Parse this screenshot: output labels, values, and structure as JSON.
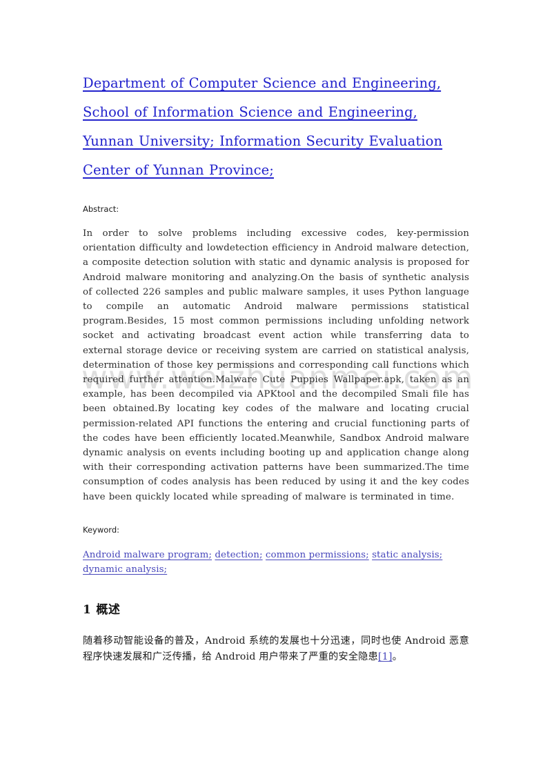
{
  "document": {
    "affiliation": {
      "lines": [
        "Department of Computer Science and Engineering,",
        "School of Information Science and Engineering,",
        "Yunnan University; Information Security ",
        "Evaluation Center of Yunnan Province;"
      ]
    },
    "abstract": {
      "label": "Abstract:",
      "text": "In order to solve problems including excessive codes, key-permission orientation difficulty and lowdetection efficiency in Android malware detection, a composite detection solution with static and dynamic analysis is proposed for Android malware monitoring and analyzing.On the basis of synthetic analysis of collected 226 samples and public malware samples, it uses Python language to compile an automatic Android malware permissions statistical program.Besides, 15 most common permissions including unfolding network socket and activating broadcast event action while transferring data to external storage device or receiving system are carried on statistical analysis, determination of those key permissions and corresponding call functions which required further attention.Malware Cute Puppies Wallpaper.apk, taken as an example, has been decompiled via APKtool and the decompiled Smali file has been obtained.By locating key codes of the malware and locating crucial permission-related API functions the entering and crucial functioning parts of the codes have been efficiently located.Meanwhile, Sandbox Android malware dynamic analysis on events including booting up and application change along with their corresponding activation patterns have been summarized.The time consumption of codes analysis has been reduced by using it and the key codes have been quickly located while spreading of malware is terminated in time."
    },
    "keywords": {
      "label": "Keyword:",
      "items": [
        "Android malware program;",
        "detection;",
        "common permissions;",
        "static analysis;",
        "dynamic analysis;"
      ]
    },
    "section": {
      "number": "1",
      "title": "概述",
      "paragraph_before_cite": "随着移动智能设备的普及，Android 系统的发展也十分迅速，同时也使 Android 恶意程序快速发展和广泛传播，给 Android 用户带来了严重的安全隐患",
      "citation": "[1]",
      "paragraph_after_cite": "。"
    },
    "watermark": {
      "text": "www.weizhuanmei.com"
    },
    "colors": {
      "affiliation_link": "#2222cc",
      "keyword_link": "#4646bb",
      "body_text": "#2e2e2e",
      "watermark": "#d9d9d9",
      "page_background": "#ffffff"
    }
  }
}
